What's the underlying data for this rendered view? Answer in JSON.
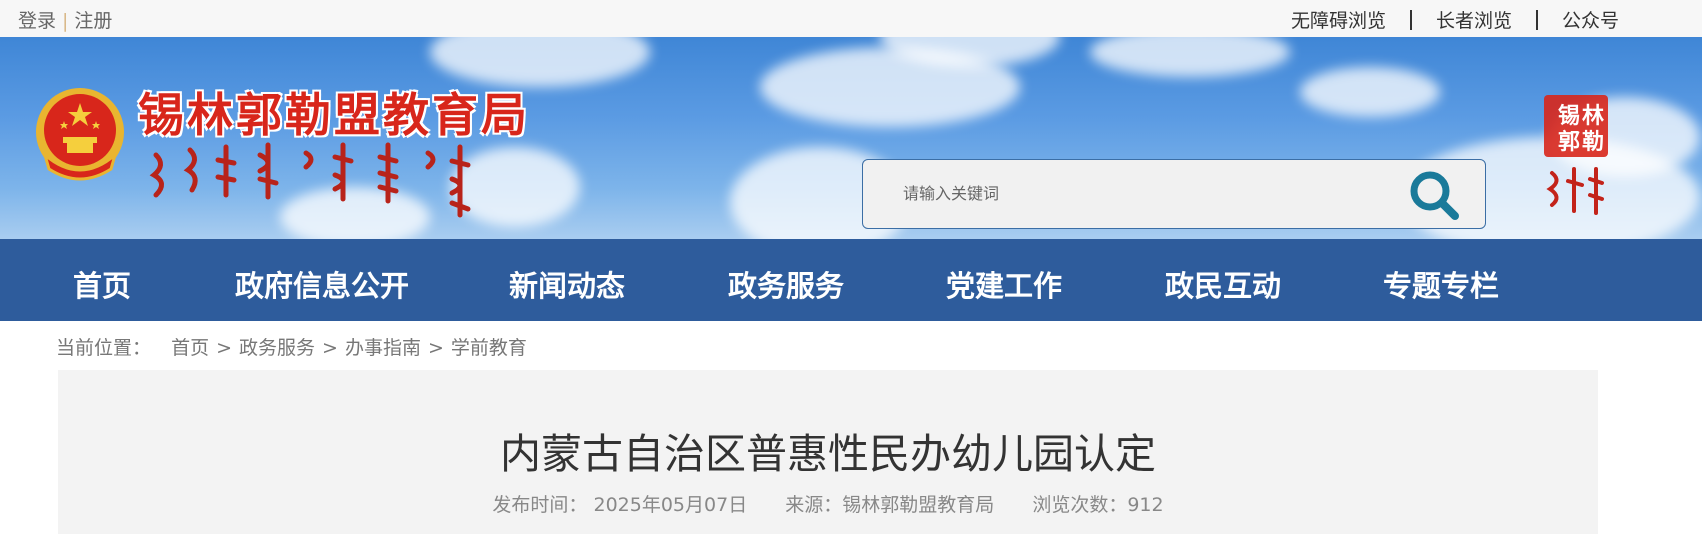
{
  "topbar": {
    "login": "登录",
    "separator": "|",
    "register": "注册",
    "accessible": "无障碍浏览",
    "elderly": "长者浏览",
    "official_account": "公众号"
  },
  "header": {
    "site_title": "锡林郭勒盟教育局",
    "emblem_icon": "national-emblem-icon",
    "search_placeholder": "请输入关键词",
    "search_icon": "search-icon",
    "seal_text": "锡林郭勒"
  },
  "nav": {
    "items": [
      "首页",
      "政府信息公开",
      "新闻动态",
      "政务服务",
      "党建工作",
      "政民互动",
      "专题专栏"
    ]
  },
  "breadcrumb": {
    "label": "当前位置：",
    "sep": ">",
    "crumbs": [
      "首页",
      "政务服务",
      "办事指南",
      "学前教育"
    ]
  },
  "article": {
    "title": "内蒙古自治区普惠性民办幼儿园认定",
    "publish_label": "发布时间：",
    "publish_date": "2025年05月07日",
    "source": "来源：锡林郭勒盟教育局",
    "views": "浏览次数：912"
  },
  "colors": {
    "nav_bg": "#2e5c9c",
    "title_red": "#d8261b",
    "search_icon": "#1a7a9a"
  }
}
